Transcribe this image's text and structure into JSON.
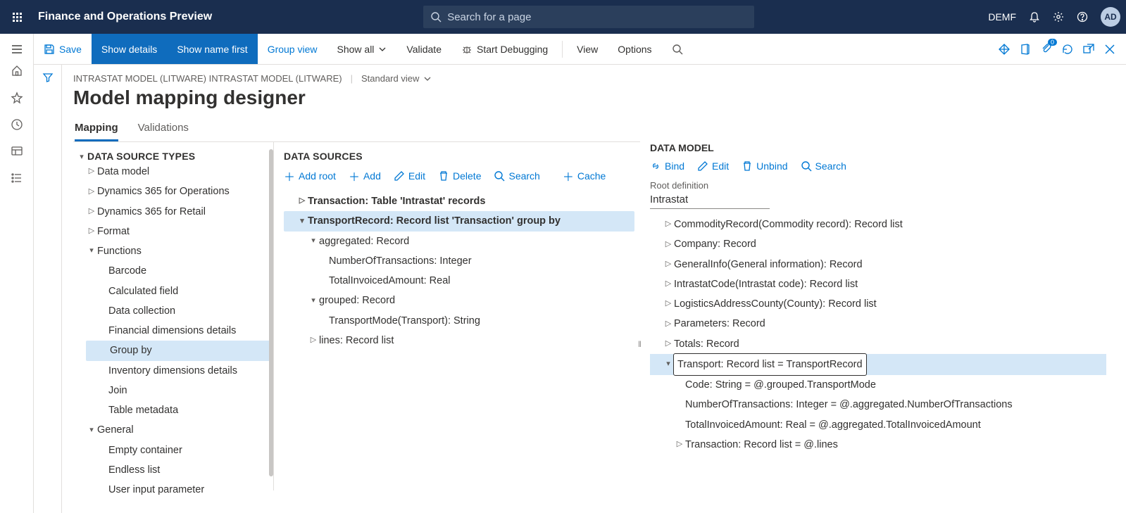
{
  "topbar": {
    "title": "Finance and Operations Preview",
    "search_placeholder": "Search for a page",
    "company": "DEMF",
    "avatar": "AD"
  },
  "cmdbar": {
    "save": "Save",
    "show_details": "Show details",
    "show_name_first": "Show name first",
    "group_view": "Group view",
    "show_all": "Show all",
    "validate": "Validate",
    "start_debug": "Start Debugging",
    "view": "View",
    "options": "Options"
  },
  "breadcrumb": {
    "path": "INTRASTAT MODEL (LITWARE) INTRASTAT MODEL (LITWARE)",
    "view": "Standard view"
  },
  "page_title": "Model mapping designer",
  "tabs": {
    "mapping": "Mapping",
    "validations": "Validations"
  },
  "dstypes": {
    "header": "DATA SOURCE TYPES",
    "items": [
      "Data model",
      "Dynamics 365 for Operations",
      "Dynamics 365 for Retail",
      "Format"
    ],
    "functions": "Functions",
    "func_items": [
      "Barcode",
      "Calculated field",
      "Data collection",
      "Financial dimensions details",
      "Group by",
      "Inventory dimensions details",
      "Join",
      "Table metadata"
    ],
    "general": "General",
    "gen_items": [
      "Empty container",
      "Endless list",
      "User input parameter"
    ]
  },
  "dsources": {
    "header": "DATA SOURCES",
    "toolbar": {
      "add_root": "Add root",
      "add": "Add",
      "edit": "Edit",
      "delete": "Delete",
      "search": "Search",
      "cache": "Cache"
    },
    "rows": {
      "transaction": "Transaction: Table 'Intrastat' records",
      "transport": "TransportRecord: Record list 'Transaction' group by",
      "aggregated": "aggregated: Record",
      "num_trans": "NumberOfTransactions: Integer",
      "total_inv": "TotalInvoicedAmount: Real",
      "grouped": "grouped: Record",
      "trans_mode": "TransportMode(Transport): String",
      "lines": "lines: Record list"
    }
  },
  "model": {
    "header": "DATA MODEL",
    "toolbar": {
      "bind": "Bind",
      "edit": "Edit",
      "unbind": "Unbind",
      "search": "Search"
    },
    "rootdef_label": "Root definition",
    "rootdef_value": "Intrastat",
    "rows": {
      "commodity": "CommodityRecord(Commodity record): Record list",
      "company": "Company: Record",
      "general": "GeneralInfo(General information): Record",
      "intrastat_code": "IntrastatCode(Intrastat code): Record list",
      "county": "LogisticsAddressCounty(County): Record list",
      "parameters": "Parameters: Record",
      "totals": "Totals: Record",
      "transport": "Transport: Record list = TransportRecord",
      "code": "Code: String = @.grouped.TransportMode",
      "num_trans": "NumberOfTransactions: Integer = @.aggregated.NumberOfTransactions",
      "total_inv": "TotalInvoicedAmount: Real = @.aggregated.TotalInvoicedAmount",
      "transaction": "Transaction: Record list = @.lines"
    }
  }
}
